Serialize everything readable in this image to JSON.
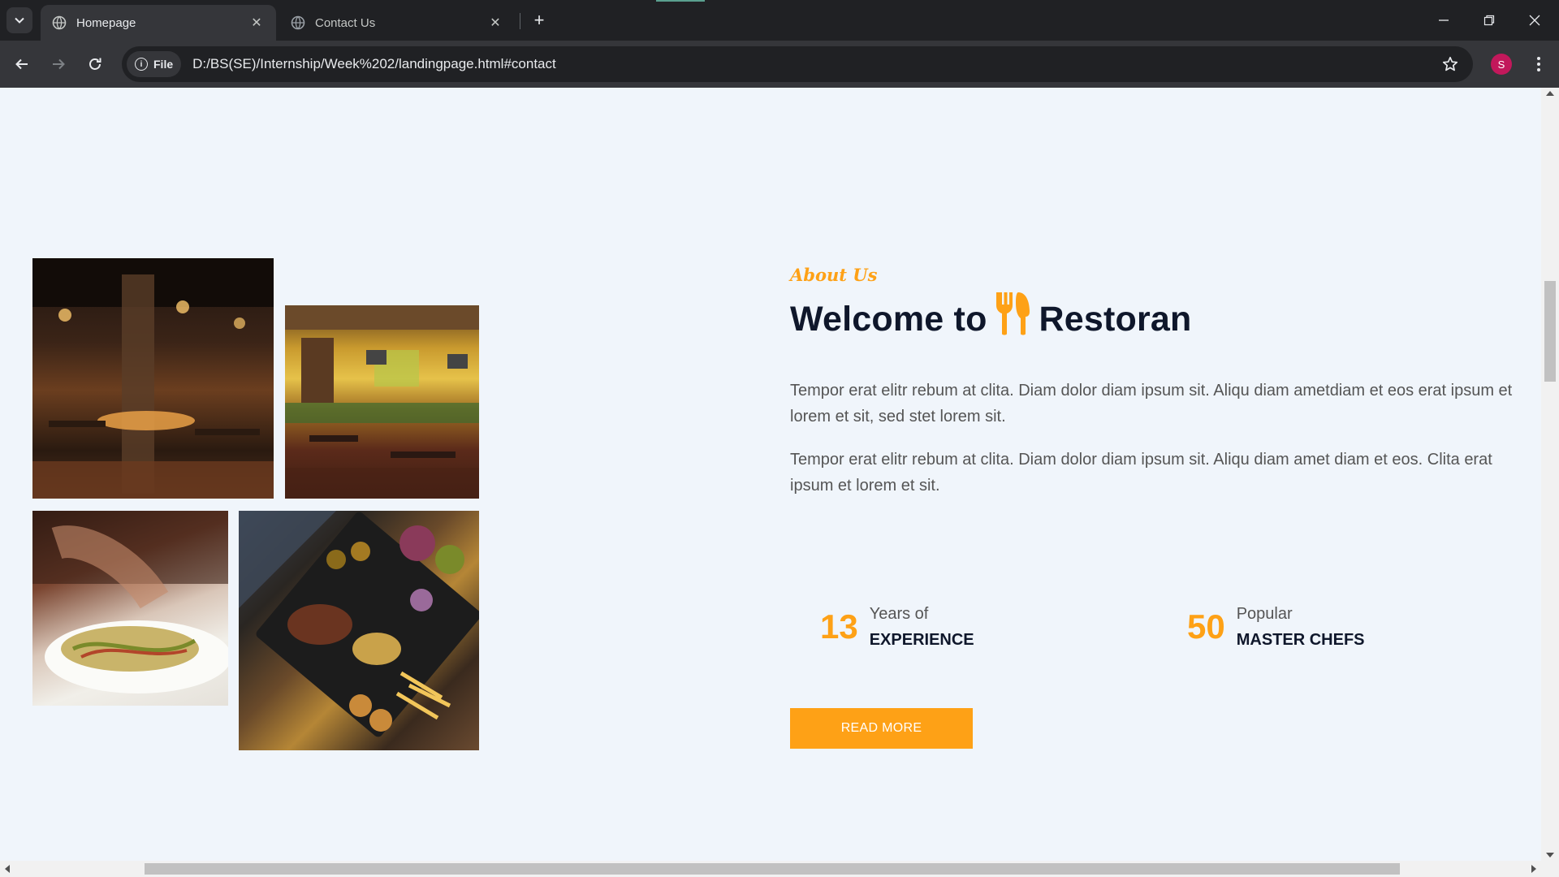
{
  "browser": {
    "tabs": [
      {
        "title": "Homepage",
        "active": true
      },
      {
        "title": "Contact Us",
        "active": false
      }
    ],
    "address": {
      "chip_label": "File",
      "url": "D:/BS(SE)/Internship/Week%202/landingpage.html#contact"
    },
    "profile_initial": "S"
  },
  "about": {
    "label": "About Us",
    "heading_before": "Welcome to",
    "heading_after": "Restoran",
    "paragraphs": [
      "Tempor erat elitr rebum at clita. Diam dolor diam ipsum sit. Aliqu diam ametdiam et eos erat ipsum et lorem et sit, sed stet lorem sit.",
      "Tempor erat elitr rebum at clita. Diam dolor diam ipsum sit. Aliqu diam amet diam et eos. Clita erat ipsum et lorem et sit."
    ],
    "stats": [
      {
        "number": "13",
        "line1": "Years of",
        "line2": "EXPERIENCE"
      },
      {
        "number": "50",
        "line1": "Popular",
        "line2": "MASTER CHEFS"
      }
    ],
    "cta_label": "READ MORE"
  },
  "images": [
    {
      "alt": "restaurant-interior-dark"
    },
    {
      "alt": "restaurant-interior-bar"
    },
    {
      "alt": "salad-dish"
    },
    {
      "alt": "grilled-platter"
    }
  ],
  "colors": {
    "accent": "#fea116",
    "dark": "#0f172b",
    "page_bg": "#f0f5fb"
  }
}
